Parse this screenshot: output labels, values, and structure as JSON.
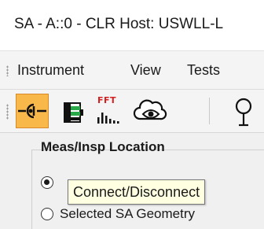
{
  "window": {
    "title": "SA - A::0 - CLR Host: USWLL-L"
  },
  "menu": {
    "items": [
      "Instrument",
      "View",
      "Tests"
    ]
  },
  "toolbar": {
    "buttons": [
      {
        "icon": "connect-disconnect-icon",
        "active": true
      },
      {
        "icon": "instrument-battery-icon",
        "active": false
      },
      {
        "icon": "fft-chart-icon",
        "fft_label": "FFT",
        "active": false
      },
      {
        "icon": "cloud-eye-icon",
        "active": false
      },
      {
        "icon": "probe-icon",
        "active": false
      }
    ]
  },
  "meas_location": {
    "title": "Meas/Insp Location",
    "options": [
      {
        "label": "",
        "selected": true
      },
      {
        "label": "Selected SA Geometry",
        "selected": false
      }
    ]
  },
  "tooltip": {
    "text": "Connect/Disconnect"
  },
  "colors": {
    "active_button": "#f8b84a",
    "tooltip_bg": "#ffffe1",
    "fft_red": "#d42020",
    "icon_green": "#2aa84a"
  }
}
